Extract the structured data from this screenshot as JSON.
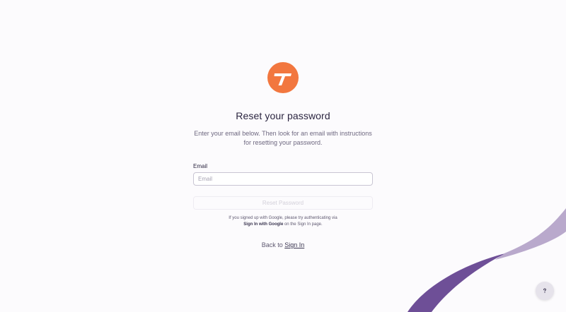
{
  "brand": {
    "logo": "brand-t-logo",
    "accent_color": "#f2773f"
  },
  "title": "Reset your password",
  "subtitle": "Enter your email below. Then look for an email with instructions for resetting your password.",
  "form": {
    "email_label": "Email",
    "email_value": "",
    "email_placeholder": "Email",
    "reset_button_label": "Reset Password"
  },
  "google_note": {
    "prefix": "If you signed up with Google, please try authenticating via",
    "bold": "Sign In with Google",
    "suffix": " on the Sign In page."
  },
  "back": {
    "prefix": "Back to ",
    "link_label": "Sign In"
  },
  "help": {
    "icon": "help-icon"
  },
  "decoration": {
    "wave_dark_color": "#6e4f97",
    "wave_light_color": "#b9a9cc"
  }
}
